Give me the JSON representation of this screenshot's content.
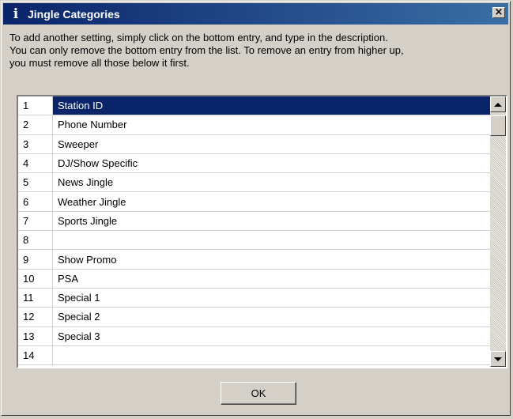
{
  "window": {
    "title": "Jingle Categories",
    "title_icon": "i",
    "close_glyph": "×"
  },
  "instructions": [
    "To add another setting, simply click on the bottom entry, and type in the description.",
    "You can only remove the bottom entry from the list. To remove an entry from higher up,",
    "you must remove all those below it first."
  ],
  "list": {
    "selected_index": 0,
    "rows": [
      {
        "num": "1",
        "desc": "Station ID"
      },
      {
        "num": "2",
        "desc": "Phone Number"
      },
      {
        "num": "3",
        "desc": "Sweeper"
      },
      {
        "num": "4",
        "desc": "DJ/Show Specific"
      },
      {
        "num": "5",
        "desc": "News Jingle"
      },
      {
        "num": "6",
        "desc": "Weather Jingle"
      },
      {
        "num": "7",
        "desc": "Sports Jingle"
      },
      {
        "num": "8",
        "desc": ""
      },
      {
        "num": "9",
        "desc": "Show Promo"
      },
      {
        "num": "10",
        "desc": "PSA"
      },
      {
        "num": "11",
        "desc": "Special 1"
      },
      {
        "num": "12",
        "desc": "Special 2"
      },
      {
        "num": "13",
        "desc": "Special 3"
      },
      {
        "num": "14",
        "desc": ""
      }
    ]
  },
  "buttons": {
    "ok_label": "OK"
  },
  "colors": {
    "selection": "#0a246a",
    "dialog_face": "#d4d0c8"
  }
}
